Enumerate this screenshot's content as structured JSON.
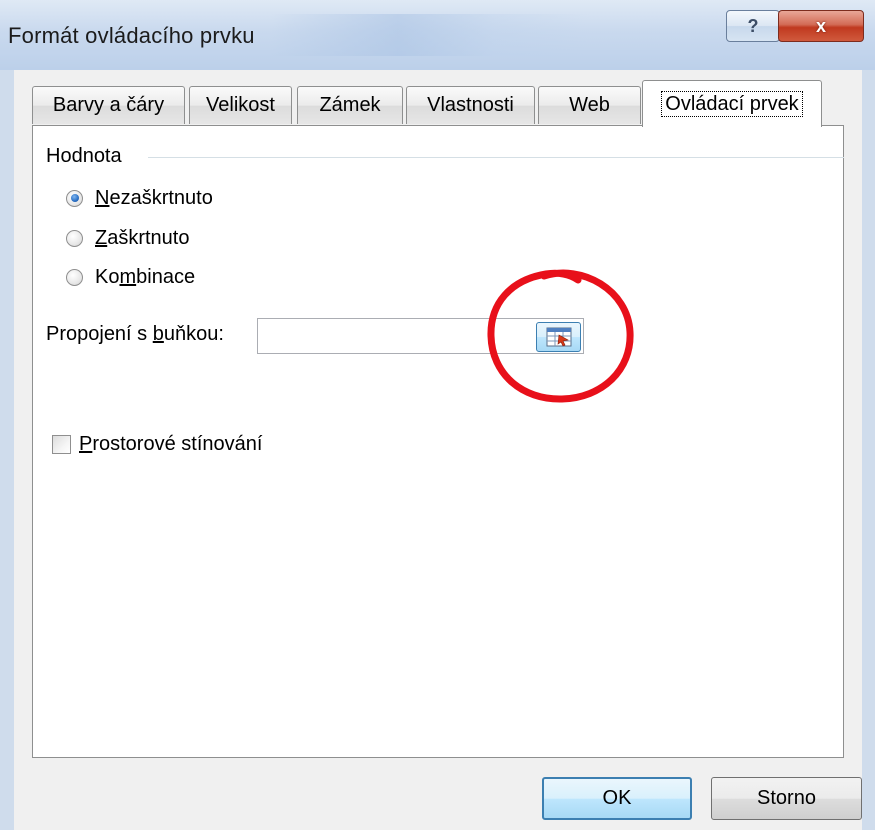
{
  "window": {
    "title": "Formát ovládacího prvku",
    "help_symbol": "?",
    "close_symbol": "x"
  },
  "tabs": [
    {
      "label": "Barvy a čáry",
      "active": false
    },
    {
      "label": "Velikost",
      "active": false
    },
    {
      "label": "Zámek",
      "active": false
    },
    {
      "label": "Vlastnosti",
      "active": false
    },
    {
      "label": "Web",
      "active": false
    },
    {
      "label": "Ovládací prvek",
      "active": true
    }
  ],
  "value_group": {
    "label": "Hodnota",
    "options": [
      {
        "pre": "",
        "accel": "N",
        "post": "ezaškrtnuto",
        "checked": true
      },
      {
        "pre": "",
        "accel": "Z",
        "post": "aškrtnuto",
        "checked": false
      },
      {
        "pre": "Ko",
        "accel": "m",
        "post": "binace",
        "checked": false
      }
    ]
  },
  "cell_link": {
    "label_pre": "Propojení s ",
    "label_accel": "b",
    "label_post": "uňkou:",
    "value": "",
    "ref_button_icon": "range-select-icon"
  },
  "shading": {
    "accel": "P",
    "label_rest": "rostorové stínování",
    "checked": false
  },
  "buttons": {
    "ok": "OK",
    "cancel": "Storno"
  },
  "annotation_color": "#e8101a"
}
